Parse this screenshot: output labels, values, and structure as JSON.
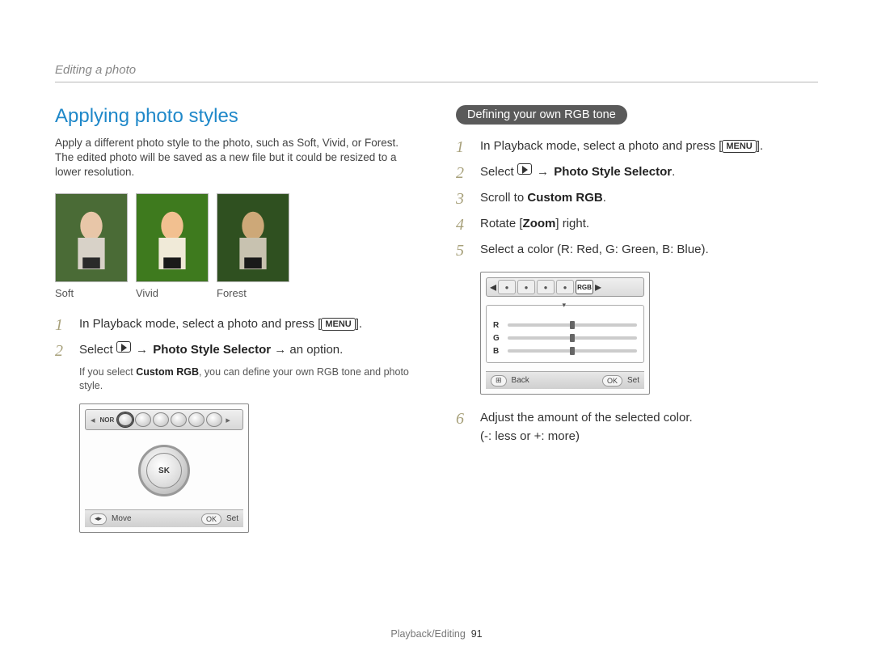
{
  "header": {
    "section": "Editing a photo"
  },
  "left": {
    "heading": "Applying photo styles",
    "intro": "Apply a different photo style to the photo, such as Soft, Vivid, or Forest. The edited photo will be saved as a new file but it could be resized to a lower resolution.",
    "thumb_labels": [
      "Soft",
      "Vivid",
      "Forest"
    ],
    "step1_a": "In Playback mode, select a photo and press [",
    "step1_menu": "MENU",
    "step1_b": "].",
    "step2_a": "Select ",
    "step2_arrow": "→",
    "step2_bold": "Photo Style Selector",
    "step2_b": " → an option.",
    "step2_sub_a": "If you select ",
    "step2_sub_bold": "Custom RGB",
    "step2_sub_b": ", you can define your own RGB tone and photo style.",
    "ui": {
      "nor": "NOR",
      "dial_label": "SK",
      "move": "Move",
      "set": "Set",
      "ok": "OK"
    }
  },
  "right": {
    "pill": "Defining your own RGB tone",
    "step1_a": "In Playback mode, select a photo and press [",
    "step1_menu": "MENU",
    "step1_b": "].",
    "step2_a": "Select ",
    "step2_arrow": "→",
    "step2_bold": "Photo Style Selector",
    "step2_b": ".",
    "step3_a": "Scroll to ",
    "step3_bold": "Custom RGB",
    "step3_b": ".",
    "step4_a": "Rotate [",
    "step4_bold": "Zoom",
    "step4_b": "] right.",
    "step5": "Select a color (R: Red, G: Green, B: Blue).",
    "step6_a": "Adjust the amount of the selected color.",
    "step6_b": "(-: less or +: more)",
    "ui": {
      "rgb_label": "RGB",
      "r": "R",
      "g": "G",
      "b": "B",
      "back": "Back",
      "set": "Set",
      "ok": "OK"
    }
  },
  "footer": {
    "section": "Playback/Editing",
    "page": "91"
  }
}
